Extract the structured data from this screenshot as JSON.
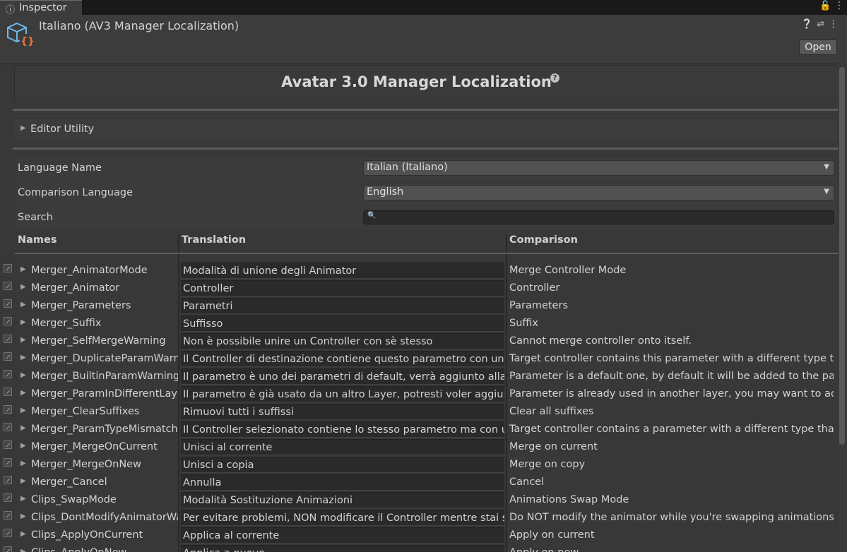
{
  "tab": {
    "label": "Inspector",
    "icon": "info-icon"
  },
  "asset": {
    "title": "Italiano (AV3 Manager Localization)",
    "icon": "scriptable-object-icon",
    "open_label": "Open"
  },
  "main": {
    "title": "Avatar 3.0 Manager Localization"
  },
  "foldout": {
    "label": "Editor Utility"
  },
  "fields": {
    "language_name_label": "Language Name",
    "language_name_value": "Italian (Italiano)",
    "comparison_label": "Comparison Language",
    "comparison_value": "English",
    "search_label": "Search",
    "search_value": ""
  },
  "columns": {
    "names": "Names",
    "translation": "Translation",
    "comparison": "Comparison"
  },
  "rows": [
    {
      "name": "Merger_AnimatorMode",
      "translation": "Modalità di unione degli Animator",
      "comparison": "Merge Controller Mode"
    },
    {
      "name": "Merger_Animator",
      "translation": "Controller",
      "comparison": "Controller"
    },
    {
      "name": "Merger_Parameters",
      "translation": "Parametri",
      "comparison": "Parameters"
    },
    {
      "name": "Merger_Suffix",
      "translation": "Suffisso",
      "comparison": "Suffix"
    },
    {
      "name": "Merger_SelfMergeWarning",
      "translation": "Non è possibile unire un Controller con sè stesso",
      "comparison": "Cannot merge controller onto itself."
    },
    {
      "name": "Merger_DuplicateParamWarn",
      "translation": "Il Controller di destinazione contiene questo parametro con un t",
      "comparison": "Target controller contains this parameter with a different type th"
    },
    {
      "name": "Merger_BuiltinParamWarning",
      "translation": "Il parametro è uno dei parametri di default, verrà aggiunto alla lis",
      "comparison": "Parameter is a default one, by default it will be added to the para"
    },
    {
      "name": "Merger_ParamInDifferentLaye",
      "translation": "Il parametro è già usato da un altro Layer, potresti voler aggiung",
      "comparison": "Parameter is already used in another layer, you may want to add"
    },
    {
      "name": "Merger_ClearSuffixes",
      "translation": "Rimuovi tutti i suffissi",
      "comparison": "Clear all suffixes"
    },
    {
      "name": "Merger_ParamTypeMismatch",
      "translation": "Il Controller selezionato contiene lo stesso parametro ma con un",
      "comparison": "Target controller contains a parameter with a different type than"
    },
    {
      "name": "Merger_MergeOnCurrent",
      "translation": "Unisci al corrente",
      "comparison": "Merge on current"
    },
    {
      "name": "Merger_MergeOnNew",
      "translation": "Unisci a copia",
      "comparison": "Merge on copy"
    },
    {
      "name": "Merger_Cancel",
      "translation": "Annulla",
      "comparison": "Cancel"
    },
    {
      "name": "Clips_SwapMode",
      "translation": "Modalità Sostituzione Animazioni",
      "comparison": "Animations Swap Mode"
    },
    {
      "name": "Clips_DontModifyAnimatorWa",
      "translation": "Per evitare problemi, NON modificare il Controller mentre stai so",
      "comparison": "Do NOT modify the animator while you're swapping animations w"
    },
    {
      "name": "Clips_ApplyOnCurrent",
      "translation": "Applica al corrente",
      "comparison": "Apply on current"
    },
    {
      "name": "Clips_ApplyOnNew",
      "translation": "Applica a nuovo",
      "comparison": "Apply on new"
    }
  ]
}
